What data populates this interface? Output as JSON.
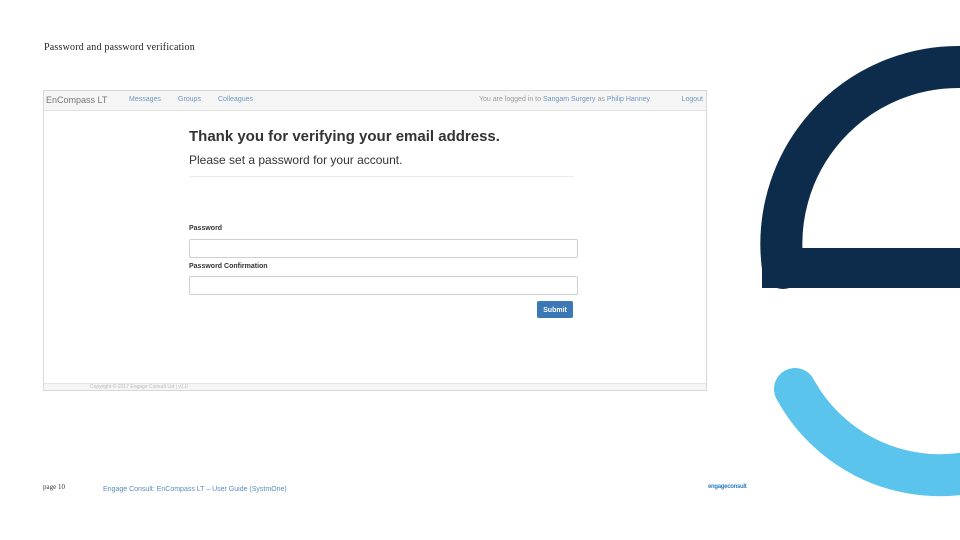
{
  "slide": {
    "title": "Password and password verification",
    "page_label": "page 10",
    "guide_title": "Engage Consult: EnCompass LT – User Guide (SystmOne)",
    "brand_mark": "engageconsult"
  },
  "navbar": {
    "brand": "EnCompass LT",
    "links": [
      "Messages",
      "Groups",
      "Colleagues"
    ],
    "status_prefix": "You are logged in to",
    "status_practice": "Sangam Surgery",
    "status_middle": "as",
    "status_user": "Philip Hanney",
    "logout": "Logout"
  },
  "form": {
    "heading": "Thank you for verifying your email address.",
    "subheading": "Please set a password for your account.",
    "password_label": "Password",
    "password_value": "",
    "confirm_label": "Password Confirmation",
    "confirm_value": "",
    "submit_label": "Submit"
  },
  "footer": {
    "text": "Copyright © 2017 Engage Consult Ltd | v1.0"
  },
  "colors": {
    "navy": "#0d2b4b",
    "sky": "#5bc4ed",
    "button": "#3b78b5"
  }
}
